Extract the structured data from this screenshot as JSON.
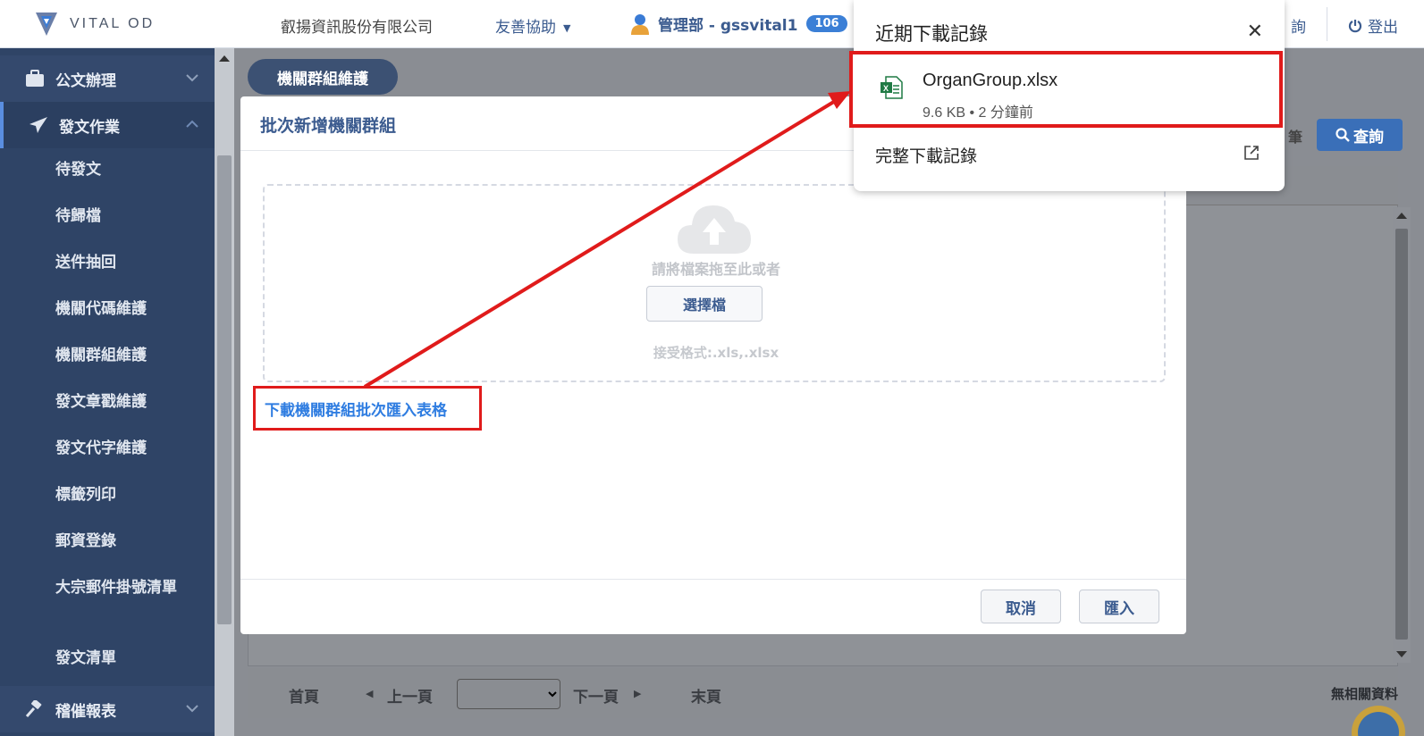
{
  "header": {
    "logo_text": "VITAL OD",
    "company": "叡揚資訊股份有限公司",
    "help": "友善協助",
    "user": "管理部 - gssvital1",
    "badge": "106",
    "query": "詢",
    "logout": "登出"
  },
  "sidebar": {
    "groups": [
      {
        "label": "公文辦理",
        "icon": "briefcase-icon"
      },
      {
        "label": "發文作業",
        "icon": "paper-plane-icon"
      },
      {
        "label": "稽催報表",
        "icon": "gavel-icon"
      }
    ],
    "sub_items": [
      "待發文",
      "待歸檔",
      "送件抽回",
      "機關代碼維護",
      "機關群組維護",
      "發文章戳維護",
      "發文代字維護",
      "標籤列印",
      "郵資登錄",
      "大宗郵件掛號清單",
      "發文清單"
    ]
  },
  "main": {
    "tab_pill": "機關群組維護",
    "query_button": "查詢",
    "partial_text": "筆",
    "pager": {
      "first": "首頁",
      "prev": "上一頁",
      "next": "下一頁",
      "last": "末頁",
      "no_data": "無相關資料"
    }
  },
  "modal": {
    "title": "批次新增機關群組",
    "drop_text": "請將檔案拖至此或者",
    "choose_file": "選擇檔",
    "formats": "接受格式:.xls,.xlsx",
    "download_link": "下載機關群組批次匯入表格",
    "cancel": "取消",
    "import": "匯入"
  },
  "downloads": {
    "title": "近期下載記錄",
    "file_name": "OrganGroup.xlsx",
    "file_meta": "9.6 KB • 2 分鐘前",
    "full_history": "完整下載記錄"
  },
  "colors": {
    "sidebar_bg": "#2f4466",
    "accent_blue": "#3b5b8f",
    "link_blue": "#2f7de1",
    "highlight_red": "#e01b1b"
  }
}
